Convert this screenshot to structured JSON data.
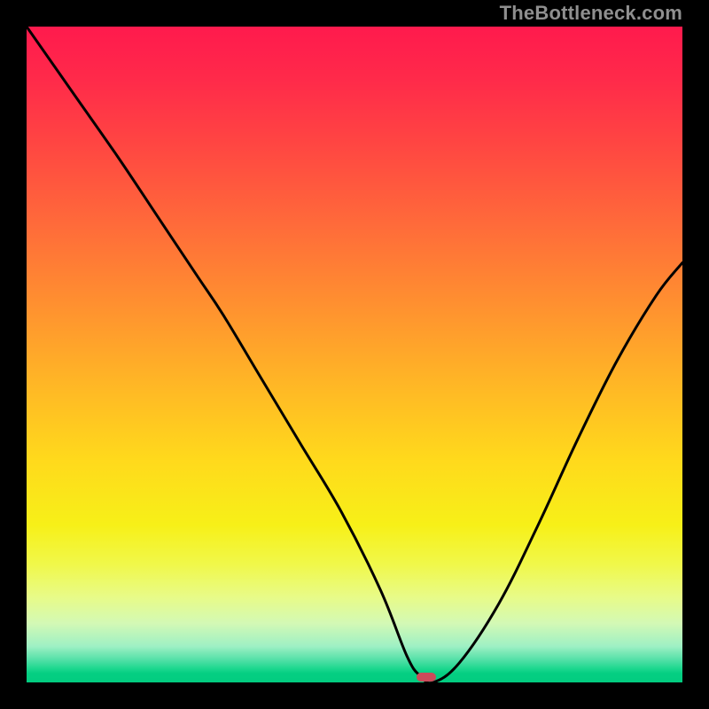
{
  "watermark": "TheBottleneck.com",
  "chart_data": {
    "type": "line",
    "title": "",
    "xlabel": "",
    "ylabel": "",
    "xlim": [
      0,
      100
    ],
    "ylim": [
      0,
      100
    ],
    "series": [
      {
        "name": "bottleneck-curve",
        "x": [
          0,
          7,
          14,
          20,
          26,
          30,
          36,
          42,
          48,
          54,
          58,
          60,
          62,
          66,
          72,
          78,
          84,
          90,
          96,
          100
        ],
        "values": [
          100,
          90,
          80,
          71,
          62,
          56,
          46,
          36,
          26,
          14,
          4,
          1,
          0,
          3,
          12,
          24,
          37,
          49,
          59,
          64
        ]
      }
    ],
    "annotations": [
      {
        "name": "optimal-marker",
        "x": 61,
        "y": 0.8
      }
    ],
    "background_gradient": {
      "top": "#ff1a4d",
      "middle": "#ffd91c",
      "bottom": "#02cc80"
    }
  }
}
